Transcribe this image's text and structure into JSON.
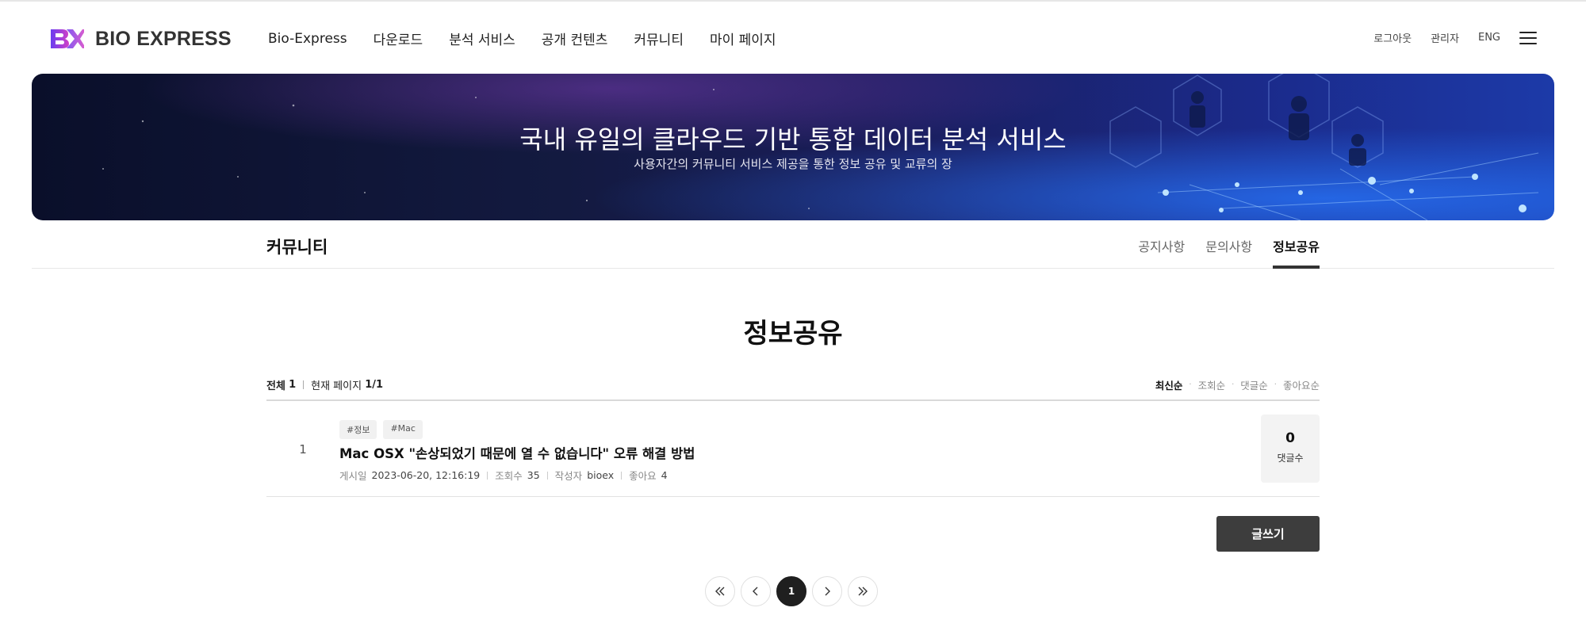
{
  "brand": {
    "name": "BIO EXPRESS",
    "colors": {
      "logo_gradient_start": "#6a3df0",
      "logo_gradient_end": "#d13fc7",
      "dark": "#333333"
    }
  },
  "nav": {
    "items": [
      {
        "label": "Bio-Express"
      },
      {
        "label": "다운로드"
      },
      {
        "label": "분석 서비스"
      },
      {
        "label": "공개 컨텐츠"
      },
      {
        "label": "커뮤니티"
      },
      {
        "label": "마이 페이지"
      }
    ],
    "util": {
      "logout": "로그아웃",
      "admin": "관리자",
      "lang": "ENG",
      "menu_icon": "hamburger-menu-icon"
    }
  },
  "banner": {
    "title": "국내 유일의 클라우드 기반 통합 데이터 분석 서비스",
    "subtitle": "사용자간의 커뮤니티 서비스 제공을 통한 정보 공유 및 교류의 장"
  },
  "subnav": {
    "title": "커뮤니티",
    "tabs": [
      {
        "label": "공지사항",
        "active": false
      },
      {
        "label": "문의사항",
        "active": false
      },
      {
        "label": "정보공유",
        "active": true
      }
    ]
  },
  "page": {
    "title": "정보공유",
    "meta": {
      "total_label": "전체",
      "total": "1",
      "page_label": "현재 페이지",
      "page": "1/1"
    },
    "sort": [
      {
        "label": "최신순",
        "active": true
      },
      {
        "label": "조회순",
        "active": false
      },
      {
        "label": "댓글순",
        "active": false
      },
      {
        "label": "좋아요순",
        "active": false
      }
    ]
  },
  "posts": [
    {
      "number": "1",
      "tags": [
        "#정보",
        "#Mac"
      ],
      "title": "Mac OSX \"손상되었기 때문에 열 수 없습니다\" 오류 해결 방법",
      "posted_label": "게시일",
      "posted": "2023-06-20, 12:16:19",
      "views_label": "조회수",
      "views": "35",
      "author_label": "작성자",
      "author": "bioex",
      "likes_label": "좋아요",
      "likes": "4",
      "comments": "0",
      "comments_label": "댓글수"
    }
  ],
  "actions": {
    "write": "글쓰기"
  },
  "pagination": {
    "current": "1",
    "icons": [
      "first-page-icon",
      "prev-page-icon",
      "next-page-icon",
      "last-page-icon"
    ]
  }
}
